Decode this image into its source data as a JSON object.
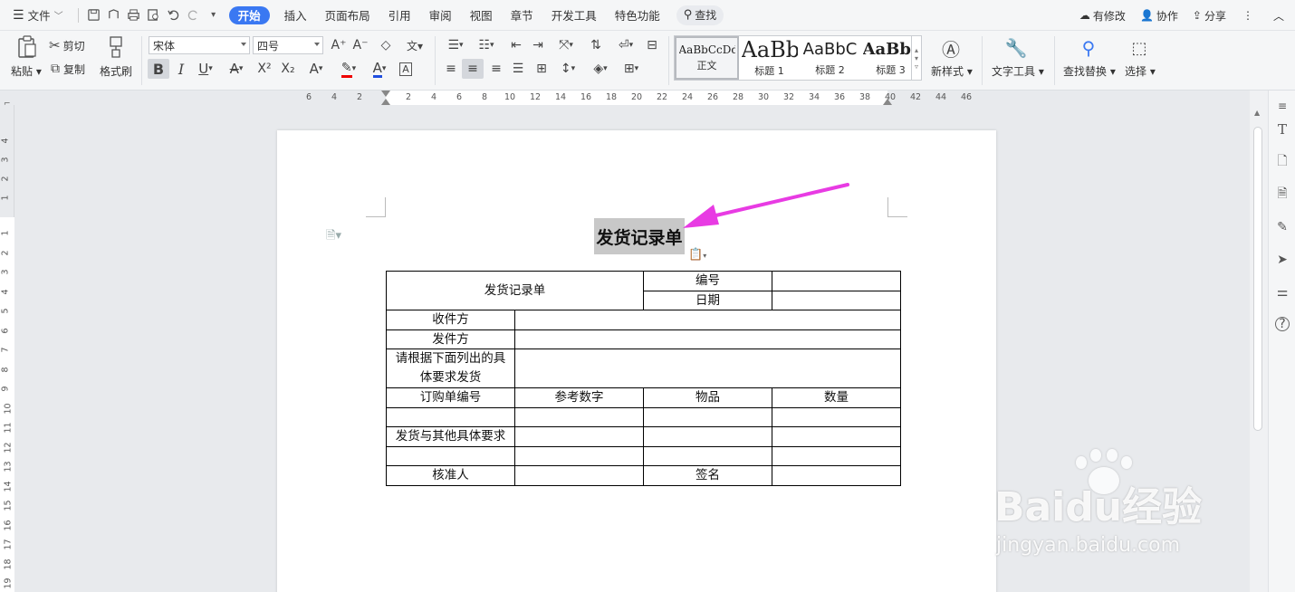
{
  "menu": {
    "file": "文件",
    "tabs": [
      "开始",
      "插入",
      "页面布局",
      "引用",
      "审阅",
      "视图",
      "章节",
      "开发工具",
      "特色功能"
    ],
    "active_tab": "开始",
    "search": "查找",
    "right": {
      "modified": "有修改",
      "collab": "协作",
      "share": "分享"
    }
  },
  "ribbon": {
    "paste": "粘贴",
    "cut": "剪切",
    "copy": "复制",
    "format_painter": "格式刷",
    "font_name": "宋体",
    "font_size": "四号",
    "styles": [
      {
        "preview": "AaBbCcDd",
        "name": "正文"
      },
      {
        "preview": "AaBb",
        "name": "标题 1"
      },
      {
        "preview": "AaBbC",
        "name": "标题 2"
      },
      {
        "preview": "AaBbC",
        "name": "标题 3"
      }
    ],
    "new_style": "新样式",
    "text_tools": "文字工具",
    "find_replace": "查找替换",
    "select": "选择"
  },
  "ruler": {
    "h_ticks": [
      "6",
      "4",
      "2",
      "2",
      "4",
      "6",
      "8",
      "10",
      "12",
      "14",
      "16",
      "18",
      "20",
      "22",
      "24",
      "26",
      "28",
      "30",
      "32",
      "34",
      "36",
      "38",
      "40",
      "42",
      "44",
      "46"
    ],
    "v_ticks_top": [
      "4",
      "3",
      "2",
      "1"
    ],
    "v_ticks": [
      "1",
      "2",
      "3",
      "4",
      "5",
      "6",
      "7",
      "8",
      "9",
      "10",
      "11",
      "12",
      "13",
      "14",
      "15",
      "16",
      "17",
      "18",
      "19"
    ]
  },
  "doc": {
    "title": "发货记录单",
    "table": {
      "header_title": "发货记录单",
      "number_label": "编号",
      "date_label": "日期",
      "receiver": "收件方",
      "sender": "发件方",
      "instructions": "请根据下面列出的具体要求发货",
      "col_order_no": "订购单编号",
      "col_ref_no": "参考数字",
      "col_item": "物品",
      "col_qty": "数量",
      "other_requirements": "发货与其他具体要求",
      "approver": "核准人",
      "signature": "签名"
    }
  },
  "watermark": {
    "brand": "Baidu经验",
    "url": "jingyan.baidu.com"
  },
  "colors": {
    "accent": "#3a78f2",
    "arrow": "#e83be3"
  }
}
